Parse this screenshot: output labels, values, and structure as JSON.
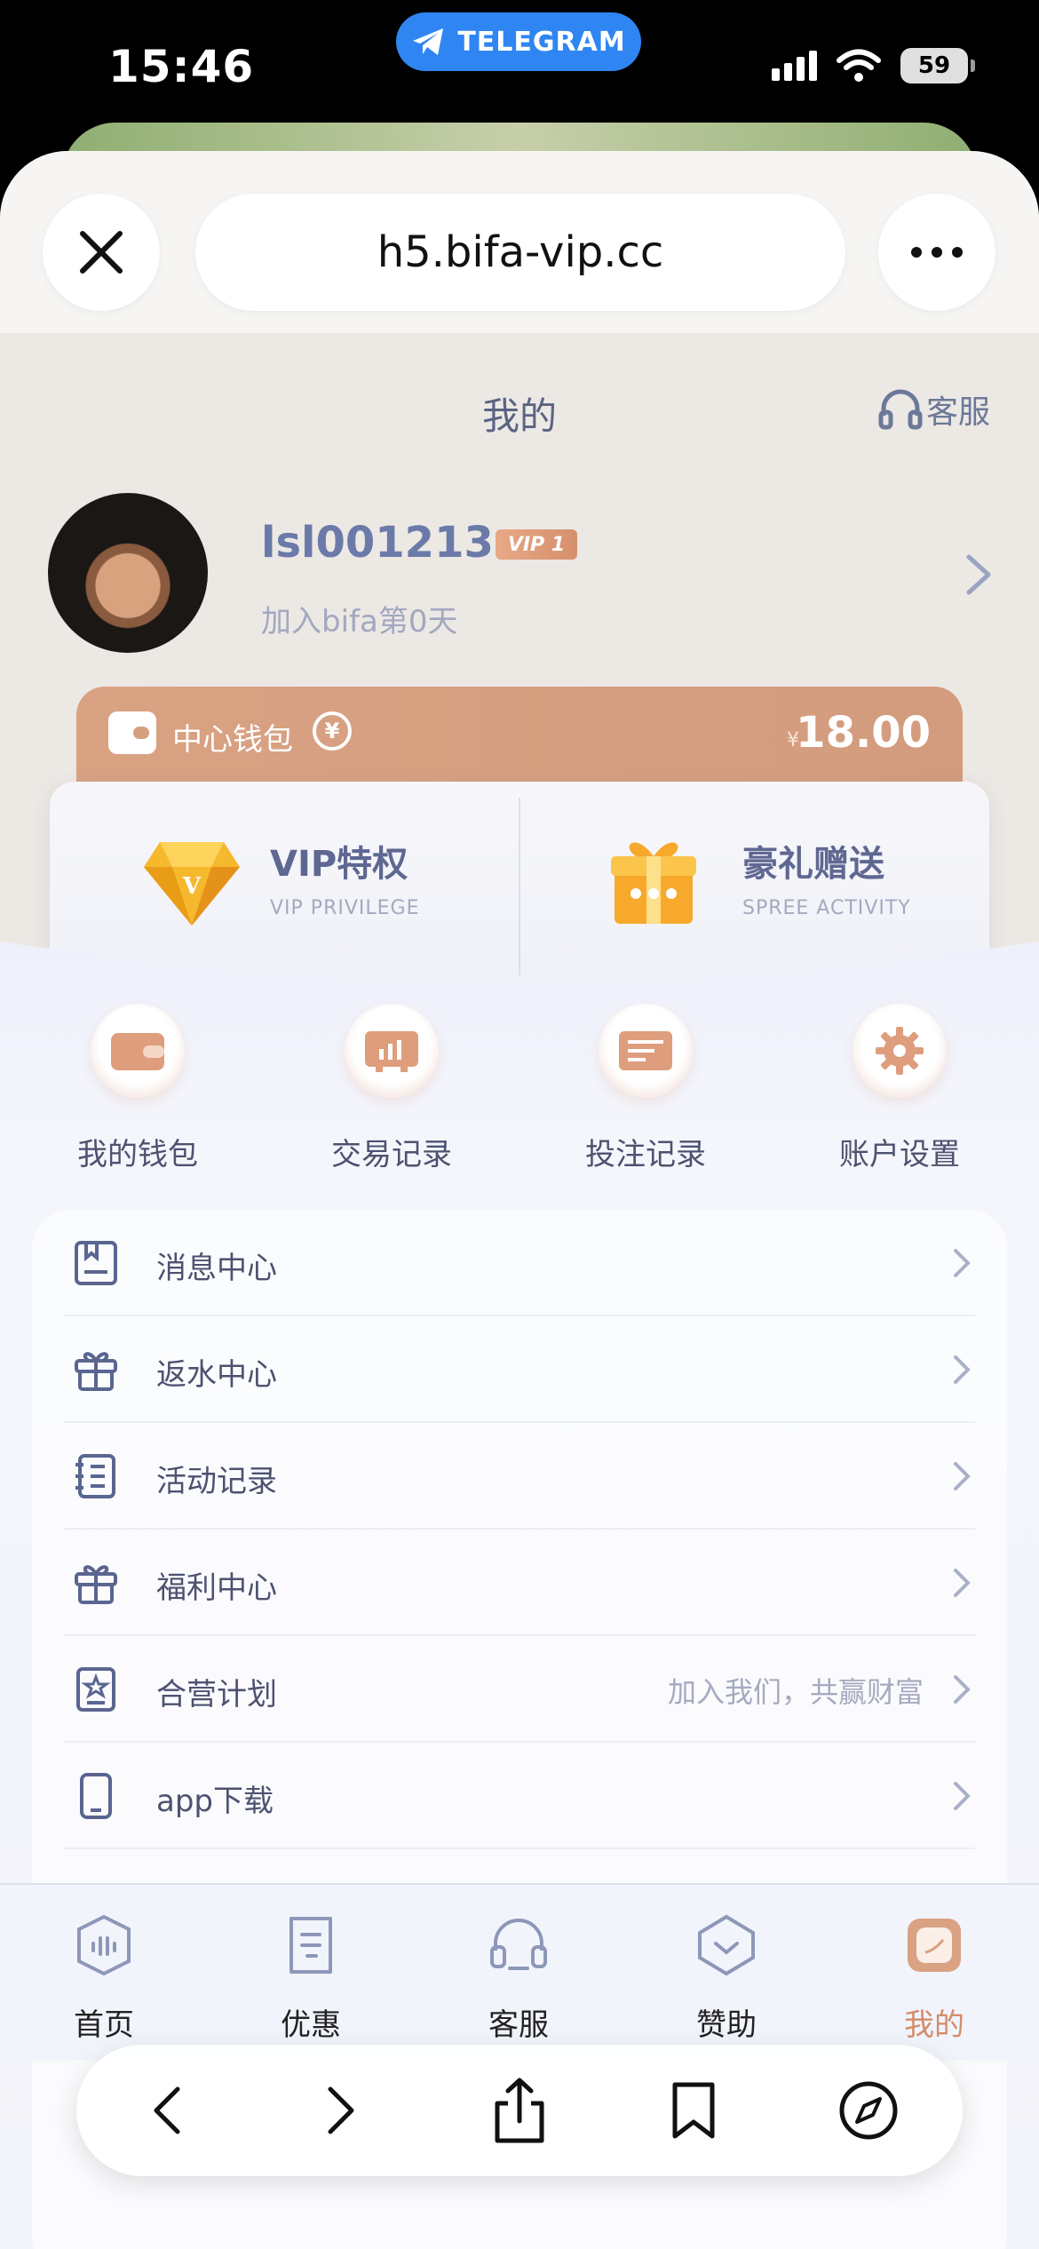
{
  "status_bar": {
    "time": "15:46",
    "telegram_label": "TELEGRAM",
    "battery": "59"
  },
  "browser": {
    "url": "h5.bifa-vip.cc",
    "close_icon": "close-icon",
    "more_icon": "more-icon"
  },
  "header": {
    "title": "我的",
    "service_label": "客服"
  },
  "profile": {
    "username": "lsl001213",
    "vip_badge": "VIP 1",
    "join_text": "加入bifa第0天"
  },
  "wallet": {
    "label": "中心钱包",
    "currency": "¥",
    "balance": "18.00"
  },
  "promos": [
    {
      "title": "VIP特权",
      "subtitle": "VIP PRIVILEGE",
      "icon": "diamond-icon"
    },
    {
      "title": "豪礼赠送",
      "subtitle": "SPREE ACTIVITY",
      "icon": "gift-box-icon"
    }
  ],
  "shortcuts": [
    {
      "label": "我的钱包",
      "icon": "wallet-icon"
    },
    {
      "label": "交易记录",
      "icon": "transaction-icon"
    },
    {
      "label": "投注记录",
      "icon": "bet-record-icon"
    },
    {
      "label": "账户设置",
      "icon": "gear-icon"
    }
  ],
  "menu": [
    {
      "label": "消息中心",
      "icon": "message-icon",
      "extra": ""
    },
    {
      "label": "返水中心",
      "icon": "gift-icon",
      "extra": ""
    },
    {
      "label": "活动记录",
      "icon": "notebook-icon",
      "extra": ""
    },
    {
      "label": "福利中心",
      "icon": "gift-icon",
      "extra": ""
    },
    {
      "label": "合营计划",
      "icon": "star-badge-icon",
      "extra": "加入我们，共赢财富"
    },
    {
      "label": "app下载",
      "icon": "phone-icon",
      "extra": ""
    }
  ],
  "tabs": [
    {
      "label": "首页",
      "icon": "home-icon",
      "active": false
    },
    {
      "label": "优惠",
      "icon": "coupon-icon",
      "active": false
    },
    {
      "label": "客服",
      "icon": "headset-icon",
      "active": false
    },
    {
      "label": "赞助",
      "icon": "sponsor-icon",
      "active": false
    },
    {
      "label": "我的",
      "icon": "profile-icon",
      "active": true
    }
  ],
  "safari_toolbar": [
    "back-icon",
    "forward-icon",
    "share-icon",
    "bookmarks-icon",
    "compass-icon"
  ],
  "colors": {
    "accent": "#d49c7e",
    "text_primary": "#4d5270",
    "text_secondary": "#a2a8bf",
    "telegram_blue": "#2f86f2"
  }
}
